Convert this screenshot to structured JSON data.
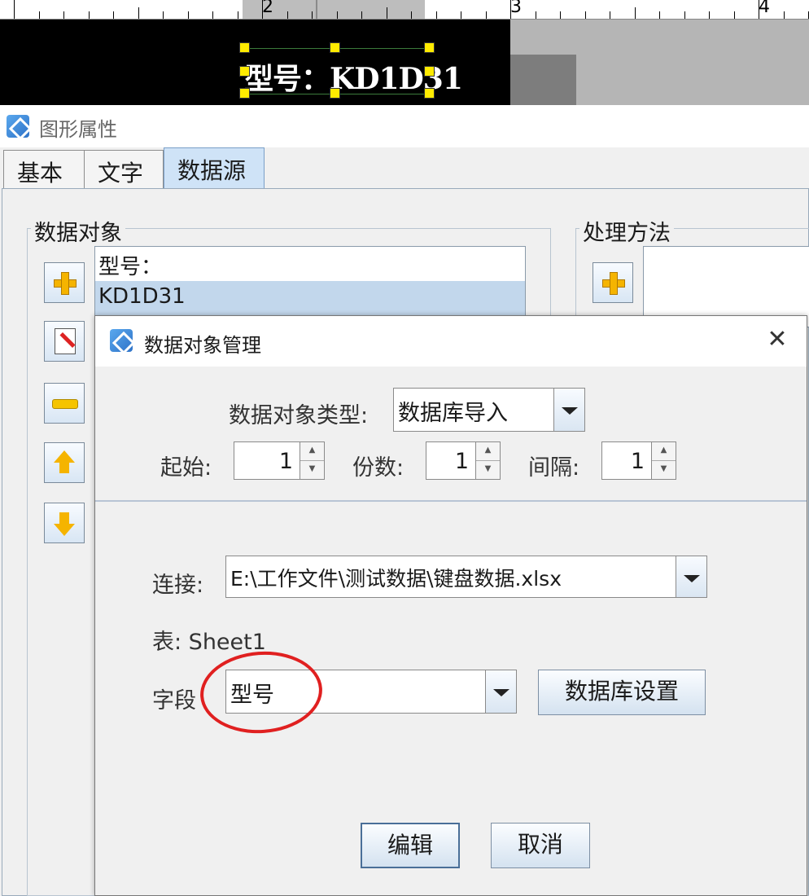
{
  "ruler": {
    "marks": [
      "2",
      "3",
      "4"
    ]
  },
  "canvas": {
    "label_text": "型号：KD1D31"
  },
  "window": {
    "title": "图形属性",
    "tabs": [
      "基本",
      "文字",
      "数据源"
    ],
    "active_tab": "数据源"
  },
  "data_objects": {
    "group_title": "数据对象",
    "items": [
      "型号：",
      "KD1D31"
    ],
    "selected_index": 1
  },
  "processing": {
    "group_title": "处理方法"
  },
  "dialog": {
    "title": "数据对象管理",
    "close_glyph": "✕",
    "type_label": "数据对象类型:",
    "type_value": "数据库导入",
    "start_label": "起始:",
    "start_value": "1",
    "copies_label": "份数:",
    "copies_value": "1",
    "interval_label": "间隔:",
    "interval_value": "1",
    "connection_label": "连接:",
    "connection_value": "E:\\工作文件\\测试数据\\键盘数据.xlsx",
    "table_text": "表: Sheet1",
    "field_label": "字段",
    "field_value": "型号",
    "db_settings_label": "数据库设置",
    "edit_label": "编辑",
    "cancel_label": "取消"
  },
  "colors": {
    "selection": "#c2d7ec",
    "annotation": "#e02020",
    "handle": "#ffeb00"
  }
}
